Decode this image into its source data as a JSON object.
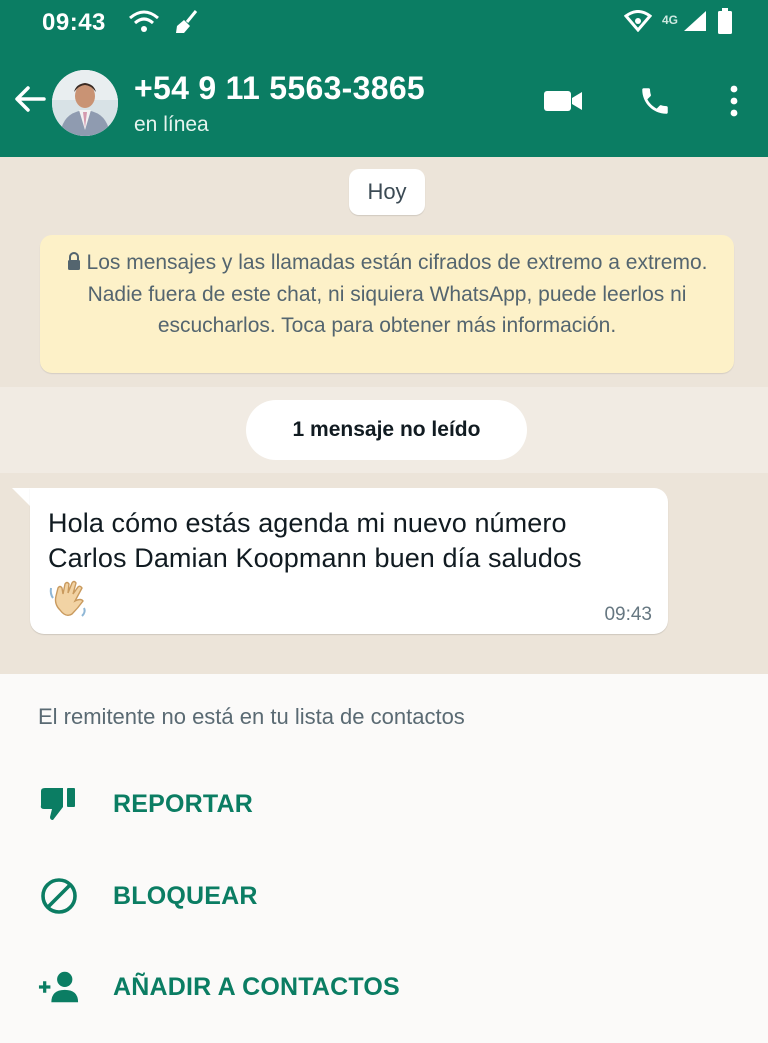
{
  "status_bar": {
    "time": "09:43",
    "network_label": "4G",
    "icons": [
      "wifi-icon",
      "broom-icon",
      "hotspot-icon",
      "signal-icon",
      "battery-icon"
    ]
  },
  "header": {
    "back_icon": "arrow-left-icon",
    "contact_name": "+54 9 11 5563-3865",
    "contact_status": "en línea",
    "actions": [
      "video-call-icon",
      "voice-call-icon",
      "more-vert-icon"
    ]
  },
  "chat": {
    "date_chip": "Hoy",
    "encryption_notice": "Los mensajes y las llamadas están cifrados de extremo a extremo. Nadie fuera de este chat, ni siquiera WhatsApp, puede leerlos ni escucharlos. Toca para obtener más información.",
    "unread_label": "1 mensaje no leído",
    "message": {
      "text": "Hola cómo estás agenda mi nuevo número Carlos Damian Koopmann buen día saludos",
      "emoji": "waving-hand",
      "time": "09:43"
    }
  },
  "unknown_panel": {
    "caption": "El remitente no está en tu lista de contactos",
    "actions": [
      {
        "label": "REPORTAR",
        "icon": "thumb-down-icon"
      },
      {
        "label": "BLOQUEAR",
        "icon": "block-icon"
      },
      {
        "label": "AÑADIR A CONTACTOS",
        "icon": "add-person-icon"
      }
    ]
  },
  "colors": {
    "header": "#0b7d63",
    "accent": "#0b7d63",
    "chat_background": "#ece4d9",
    "system_notice": "#fdf1c8"
  }
}
